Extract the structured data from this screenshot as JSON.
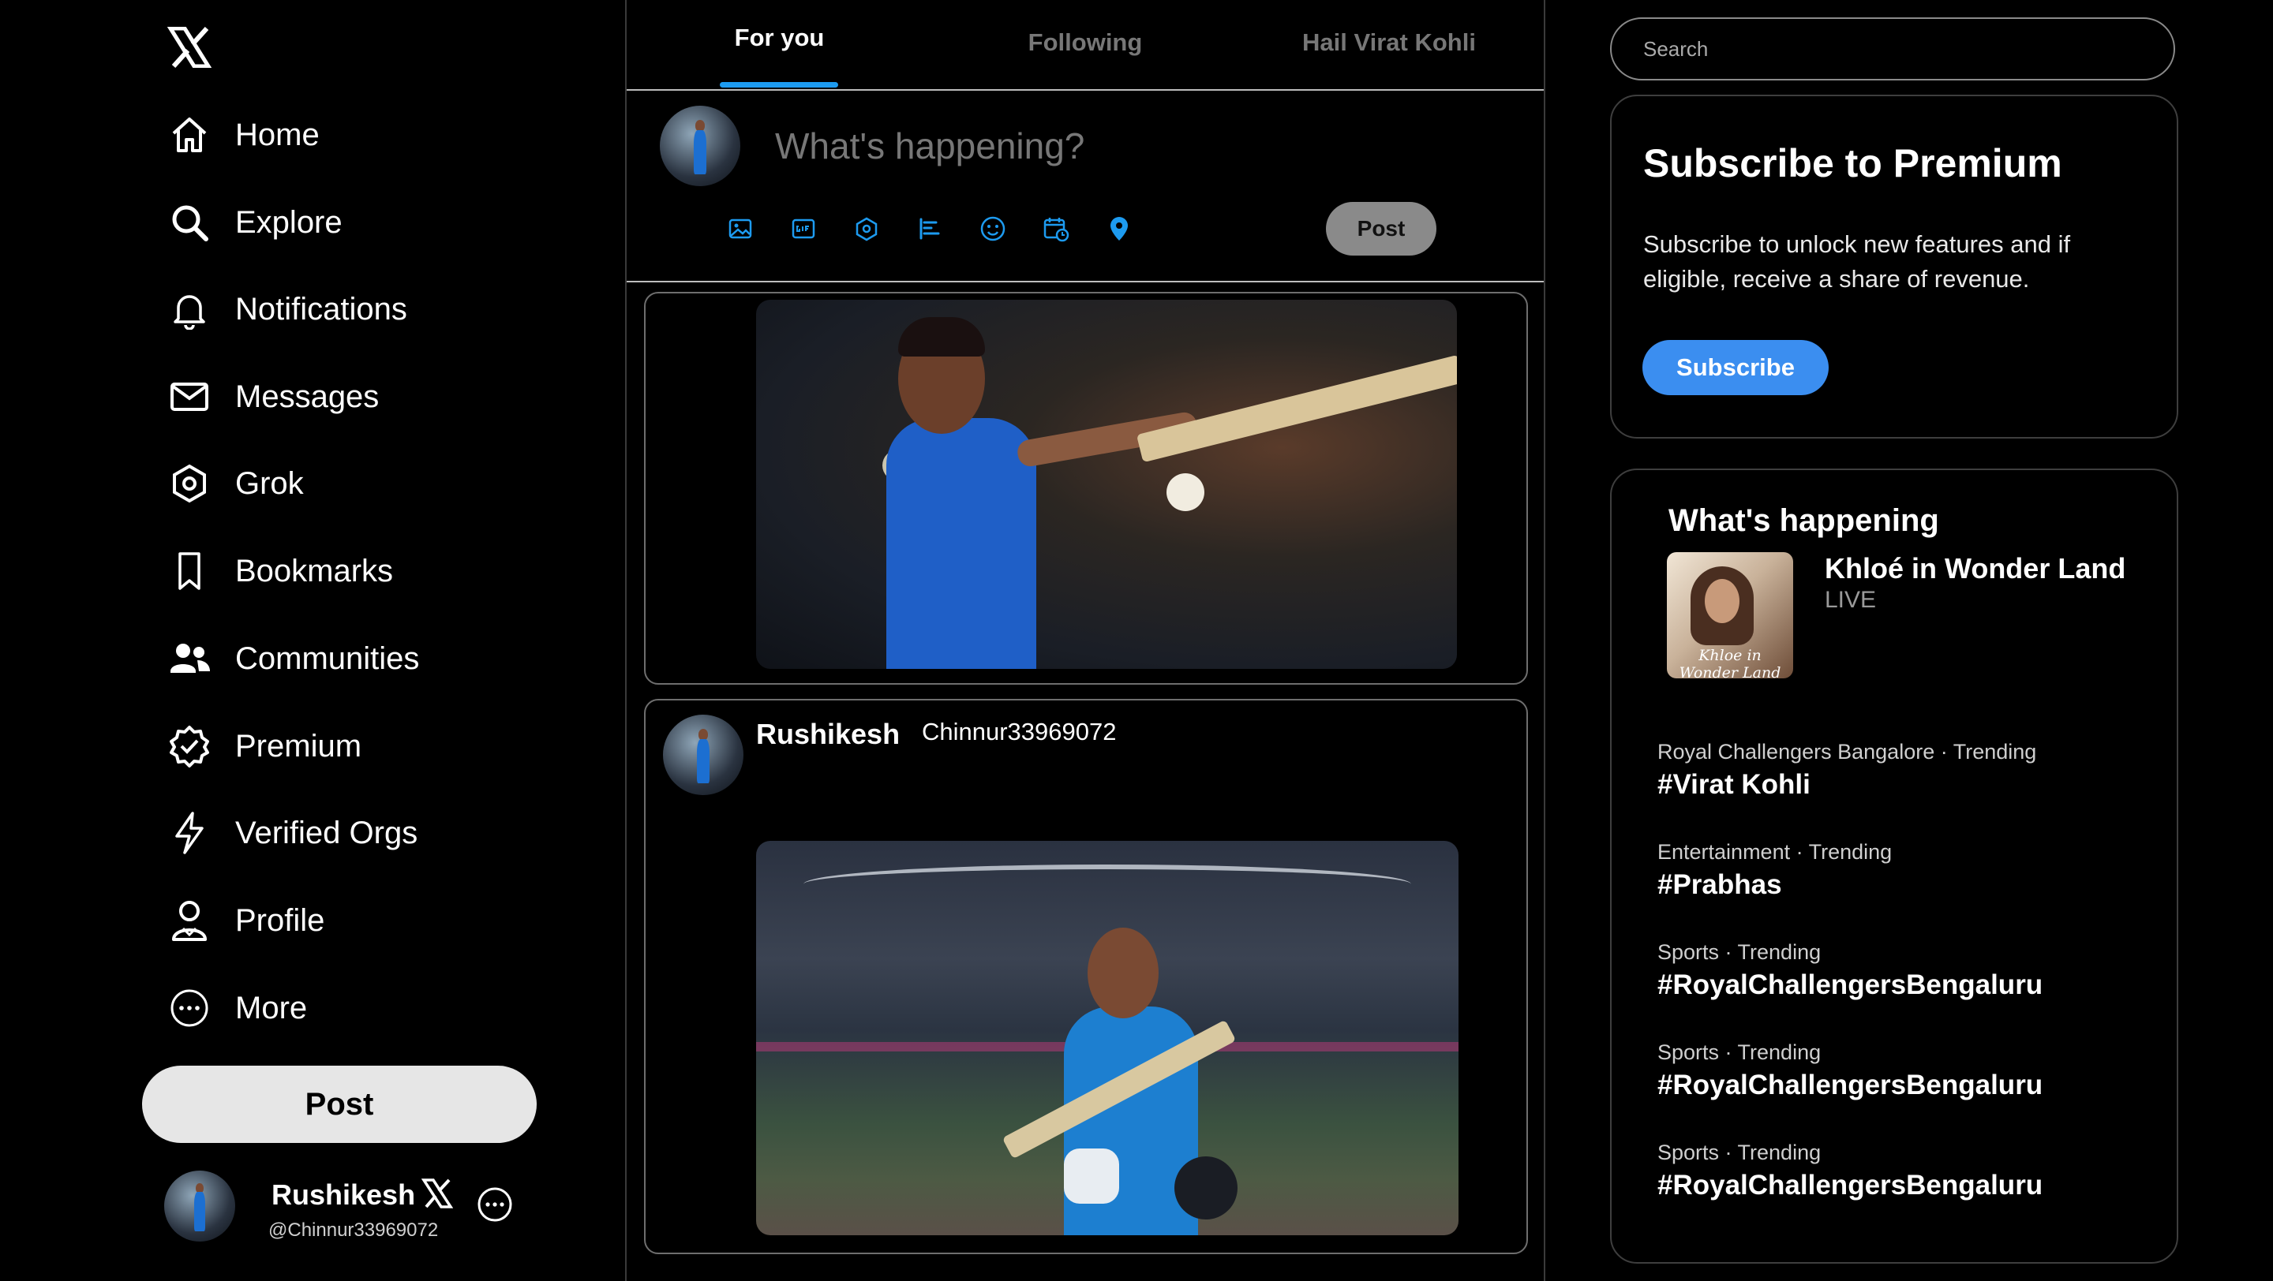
{
  "nav": {
    "items": [
      {
        "label": "Home",
        "icon": "home-icon"
      },
      {
        "label": "Explore",
        "icon": "search-icon"
      },
      {
        "label": "Notifications",
        "icon": "bell-icon"
      },
      {
        "label": "Messages",
        "icon": "envelope-icon"
      },
      {
        "label": "Grok",
        "icon": "grok-icon"
      },
      {
        "label": "Bookmarks",
        "icon": "bookmark-icon"
      },
      {
        "label": "Communities",
        "icon": "people-icon"
      },
      {
        "label": "Premium",
        "icon": "verified-badge-icon"
      },
      {
        "label": "Verified Orgs",
        "icon": "lightning-icon"
      },
      {
        "label": "Profile",
        "icon": "person-icon"
      },
      {
        "label": "More",
        "icon": "more-circle-icon"
      }
    ],
    "post_label": "Post"
  },
  "account": {
    "name": "Rushikesh",
    "handle": "@Chinnur33969072"
  },
  "tabs": [
    {
      "label": "For you",
      "active": true
    },
    {
      "label": "Following",
      "active": false
    },
    {
      "label": "Hail Virat Kohli",
      "active": false
    }
  ],
  "compose": {
    "placeholder": "What's happening?",
    "post_label": "Post",
    "tools": [
      "image-icon",
      "gif-icon",
      "grok-icon",
      "poll-icon",
      "emoji-icon",
      "schedule-icon",
      "location-icon"
    ]
  },
  "feed": {
    "posts": [
      {
        "name": "Rushikesh",
        "handle": "Chinnur33969072"
      }
    ]
  },
  "search": {
    "placeholder": "Search"
  },
  "premium": {
    "title": "Subscribe to Premium",
    "body": "Subscribe to unlock new features and if eligible, receive a share of revenue.",
    "button": "Subscribe"
  },
  "happening": {
    "title": "What's happening",
    "live": {
      "title": "Khloé in Wonder Land",
      "status": "LIVE",
      "thumb_text": "Khloe in Wonder Land"
    },
    "trends": [
      {
        "meta": "Royal Challengers Bangalore · Trending",
        "name": "#Virat Kohli"
      },
      {
        "meta": "Entertainment · Trending",
        "name": "#Prabhas"
      },
      {
        "meta": "Sports · Trending",
        "name": "#RoyalChallengersBengaluru"
      },
      {
        "meta": "Sports · Trending",
        "name": "#RoyalChallengersBengaluru"
      },
      {
        "meta": "Sports · Trending",
        "name": "#RoyalChallengersBengaluru"
      }
    ]
  },
  "colors": {
    "accent": "#1d9bf0",
    "subscribe": "#3b8ef0",
    "background": "#000000"
  }
}
